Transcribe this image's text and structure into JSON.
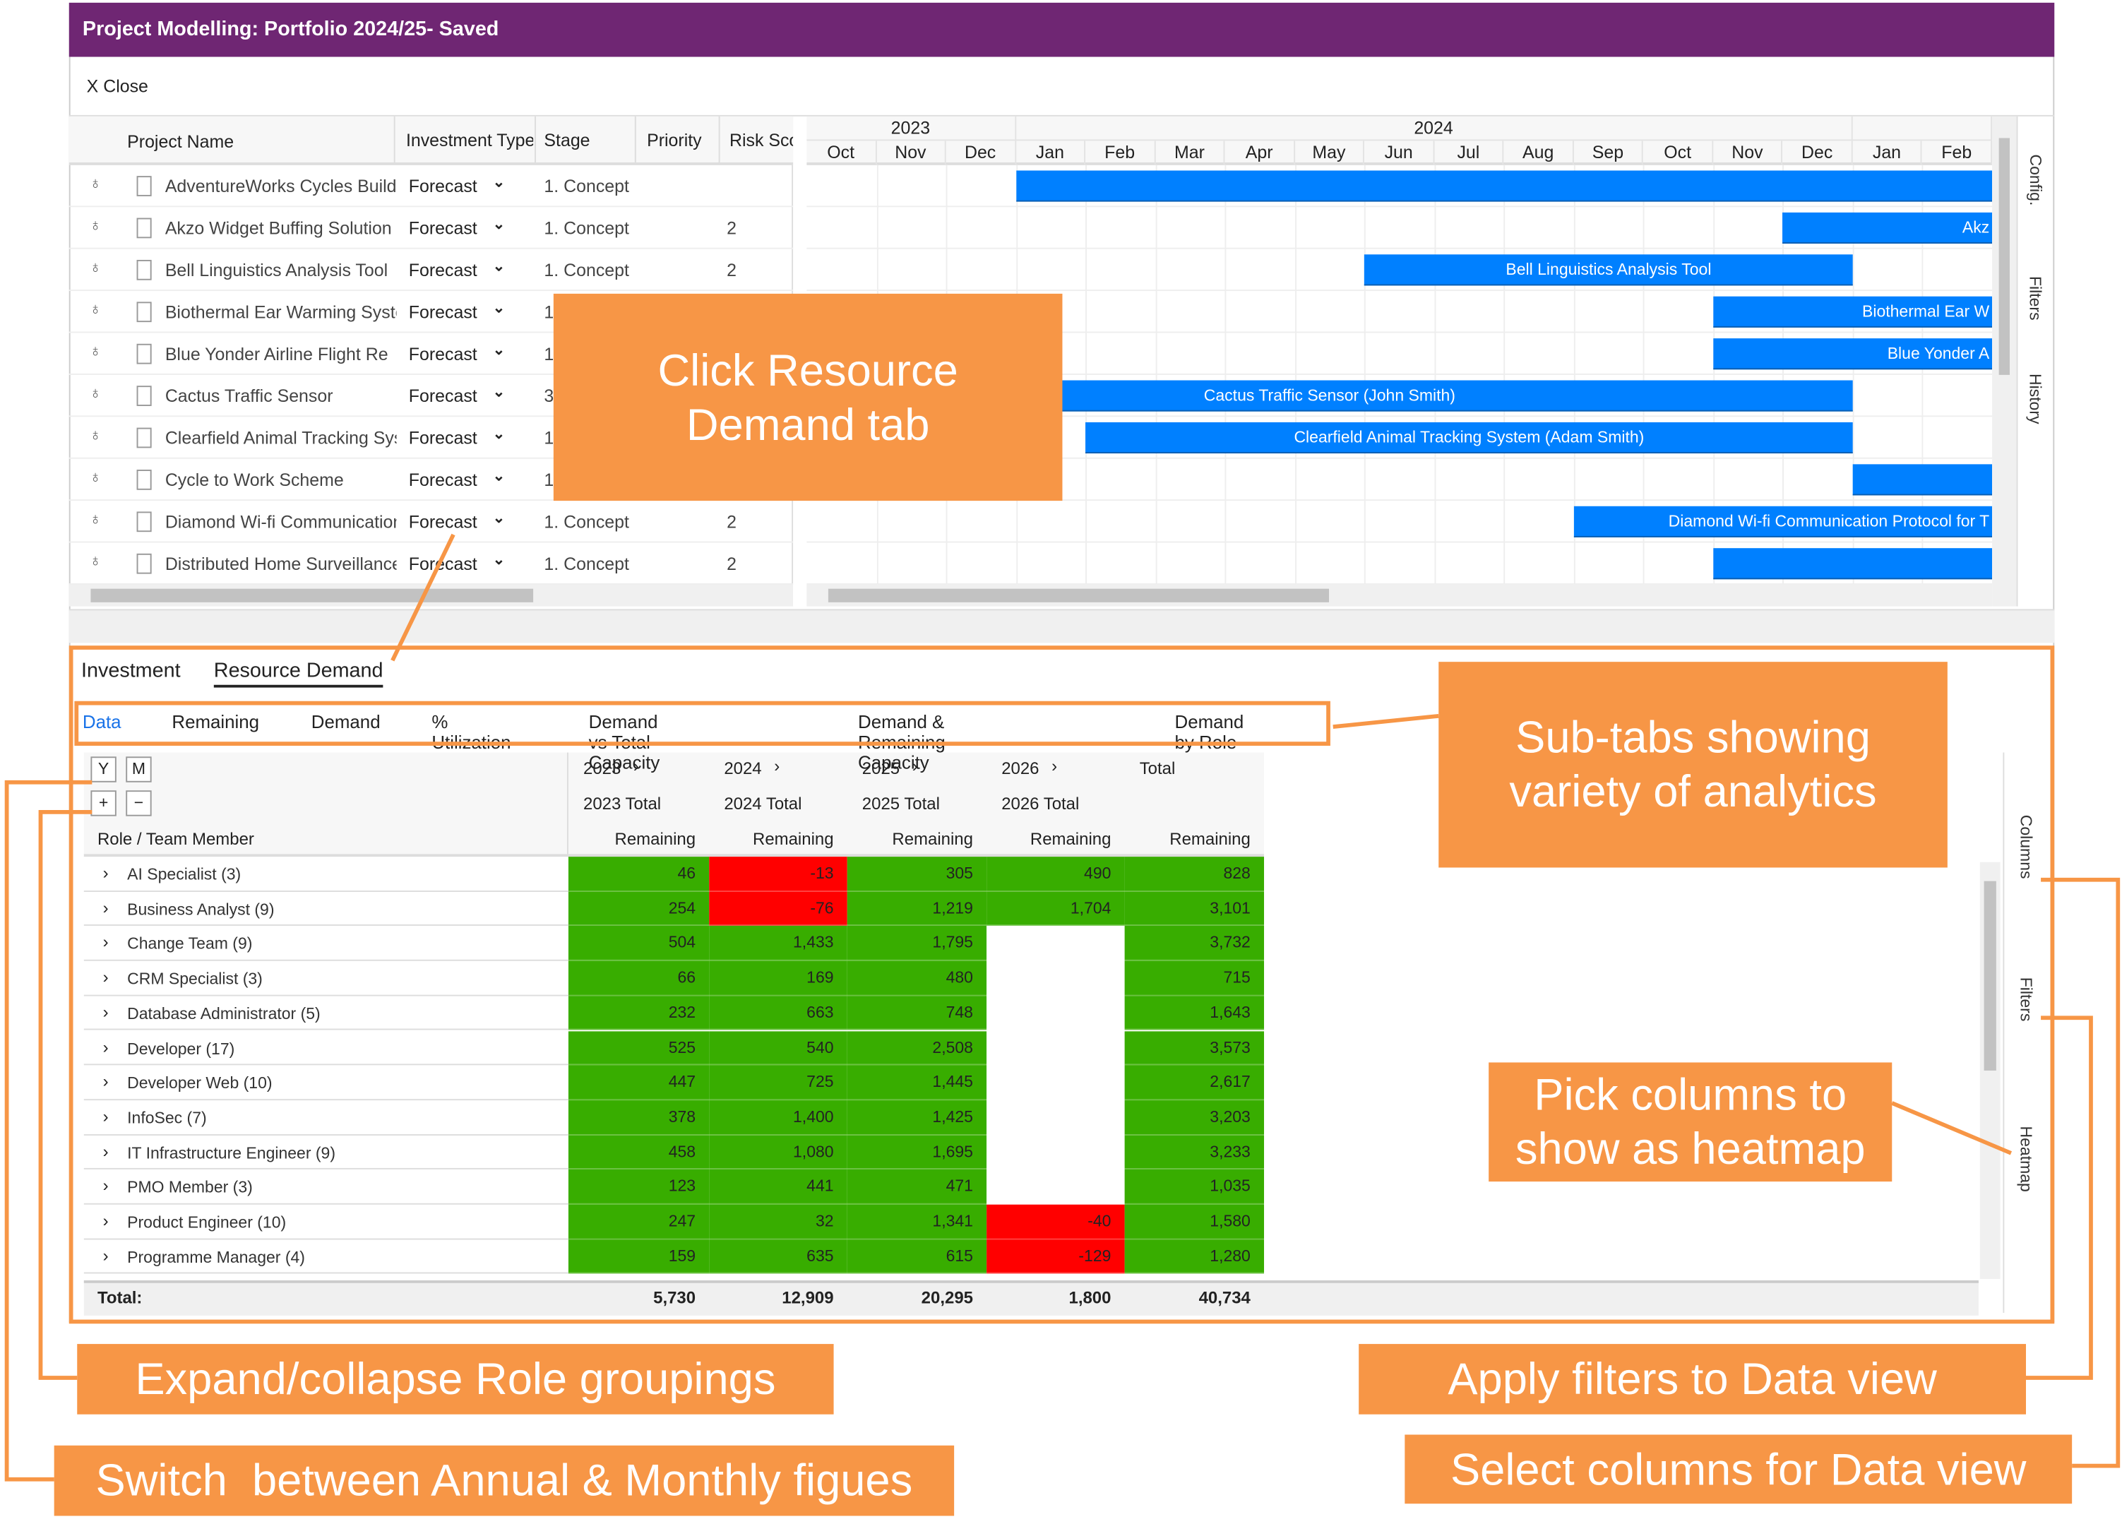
{
  "title": "Project Modelling: Portfolio 2024/25- Saved",
  "close_label": "X  Close",
  "grid": {
    "columns": [
      "Project Name",
      "Investment Type",
      "Stage",
      "Priority",
      "Risk Score"
    ],
    "rows": [
      {
        "name": "AdventureWorks Cycles Build",
        "type": "Forecast",
        "stage": "1. Concept",
        "priority": "",
        "risk": ""
      },
      {
        "name": "Akzo Widget Buffing Solution",
        "type": "Forecast",
        "stage": "1. Concept",
        "priority": "",
        "risk": "2"
      },
      {
        "name": "Bell Linguistics Analysis Tool",
        "type": "Forecast",
        "stage": "1. Concept",
        "priority": "",
        "risk": "2"
      },
      {
        "name": "Biothermal Ear Warming System",
        "type": "Forecast",
        "stage": "1. Concept",
        "priority": "",
        "risk": ""
      },
      {
        "name": "Blue Yonder Airline Flight Re",
        "type": "Forecast",
        "stage": "1. Concept",
        "priority": "",
        "risk": ""
      },
      {
        "name": "Cactus Traffic Sensor",
        "type": "Forecast",
        "stage": "3",
        "priority": "",
        "risk": ""
      },
      {
        "name": "Clearfield Animal Tracking System",
        "type": "Forecast",
        "stage": "1. Concept",
        "priority": "",
        "risk": ""
      },
      {
        "name": "Cycle to Work Scheme",
        "type": "Forecast",
        "stage": "1. Concept",
        "priority": "",
        "risk": ""
      },
      {
        "name": "Diamond Wi-fi Communication",
        "type": "Forecast",
        "stage": "1. Concept",
        "priority": "",
        "risk": "2"
      },
      {
        "name": "Distributed Home Surveillance",
        "type": "Forecast",
        "stage": "1. Concept",
        "priority": "",
        "risk": "2"
      }
    ]
  },
  "gantt": {
    "years": [
      {
        "label": "2023",
        "start": 0,
        "span": 3
      },
      {
        "label": "2024",
        "start": 3,
        "span": 12
      },
      {
        "label": "",
        "start": 15,
        "span": 2
      }
    ],
    "months": [
      "Oct",
      "Nov",
      "Dec",
      "Jan",
      "Feb",
      "Mar",
      "Apr",
      "May",
      "Jun",
      "Jul",
      "Aug",
      "Sep",
      "Oct",
      "Nov",
      "Dec",
      "Jan",
      "Feb"
    ],
    "bars": [
      {
        "start": "2024-01",
        "end": null,
        "label": ""
      },
      {
        "start": "2024-12",
        "end": null,
        "label": "Akz"
      },
      {
        "start": "2024-06",
        "end": "2024-12",
        "label": "Bell Linguistics Analysis Tool"
      },
      {
        "start": "2024-11",
        "end": null,
        "label": "Biothermal Ear W"
      },
      {
        "start": "2024-11",
        "end": null,
        "label": "Blue Yonder A"
      },
      {
        "start": "2023-10",
        "end": "2024-12",
        "label": "Cactus Traffic Sensor (John Smith)"
      },
      {
        "start": "2024-02",
        "end": "2024-12",
        "label": "Clearfield Animal Tracking System (Adam Smith)"
      },
      {
        "start": "2025-01",
        "end": null,
        "label": ""
      },
      {
        "start": "2024-09",
        "end": null,
        "label": "Diamond Wi-fi Communication Protocol for T"
      },
      {
        "start": "2024-11",
        "end": null,
        "label": ""
      }
    ]
  },
  "side_panel_top": [
    "Config.",
    "Filters",
    "History"
  ],
  "tabs": [
    "Investment",
    "Resource Demand"
  ],
  "active_tab": 1,
  "subtabs": [
    "Data",
    "Remaining",
    "Demand",
    "% Utilization",
    "Demand vs Total Capacity",
    "Demand & Remaining Capacity",
    "Demand by Role"
  ],
  "active_subtab": 0,
  "pivot": {
    "buttons": {
      "year": "Y",
      "month": "M",
      "expand": "+",
      "collapse": "−"
    },
    "years": [
      "2023",
      "2024",
      "2025",
      "2026",
      "Total"
    ],
    "totals": [
      "2023 Total",
      "2024 Total",
      "2025 Total",
      "2026 Total",
      ""
    ],
    "row_header": "Role / Team Member",
    "measure": "Remaining",
    "rows": [
      {
        "role": "AI Specialist (3)",
        "values": [
          "46",
          "-13",
          "305",
          "490",
          "828"
        ],
        "heat": [
          "g",
          "r",
          "g",
          "g",
          "g"
        ]
      },
      {
        "role": "Business Analyst (9)",
        "values": [
          "254",
          "-76",
          "1,219",
          "1,704",
          "3,101"
        ],
        "heat": [
          "g",
          "r",
          "g",
          "g",
          "g"
        ]
      },
      {
        "role": "Change Team (9)",
        "values": [
          "504",
          "1,433",
          "1,795",
          "",
          "3,732"
        ],
        "heat": [
          "g",
          "g",
          "g",
          "w",
          "g"
        ]
      },
      {
        "role": "CRM Specialist (3)",
        "values": [
          "66",
          "169",
          "480",
          "",
          "715"
        ],
        "heat": [
          "g",
          "g",
          "g",
          "w",
          "g"
        ]
      },
      {
        "role": "Database Administrator (5)",
        "values": [
          "232",
          "663",
          "748",
          "",
          "1,643"
        ],
        "heat": [
          "g",
          "g",
          "g",
          "w",
          "g"
        ]
      },
      {
        "role": "Developer (17)",
        "values": [
          "525",
          "540",
          "2,508",
          "",
          "3,573"
        ],
        "heat": [
          "g",
          "g",
          "g",
          "w",
          "g"
        ]
      },
      {
        "role": "Developer Web (10)",
        "values": [
          "447",
          "725",
          "1,445",
          "",
          "2,617"
        ],
        "heat": [
          "g",
          "g",
          "g",
          "w",
          "g"
        ]
      },
      {
        "role": "InfoSec (7)",
        "values": [
          "378",
          "1,400",
          "1,425",
          "",
          "3,203"
        ],
        "heat": [
          "g",
          "g",
          "g",
          "w",
          "g"
        ]
      },
      {
        "role": "IT Infrastructure Engineer (9)",
        "values": [
          "458",
          "1,080",
          "1,695",
          "",
          "3,233"
        ],
        "heat": [
          "g",
          "g",
          "g",
          "w",
          "g"
        ]
      },
      {
        "role": "PMO Member (3)",
        "values": [
          "123",
          "441",
          "471",
          "",
          "1,035"
        ],
        "heat": [
          "g",
          "g",
          "g",
          "w",
          "g"
        ]
      },
      {
        "role": "Product Engineer (10)",
        "values": [
          "247",
          "32",
          "1,341",
          "-40",
          "1,580"
        ],
        "heat": [
          "g",
          "g",
          "g",
          "r",
          "g"
        ]
      },
      {
        "role": "Programme Manager (4)",
        "values": [
          "159",
          "635",
          "615",
          "-129",
          "1,280"
        ],
        "heat": [
          "g",
          "g",
          "g",
          "r",
          "g"
        ]
      }
    ],
    "total_label": "Total:",
    "total_values": [
      "5,730",
      "12,909",
      "20,295",
      "1,800",
      "40,734"
    ]
  },
  "side_panel_bottom": [
    "Columns",
    "Filters",
    "Heatmap"
  ],
  "colors": {
    "title": "#6f2673",
    "bar": "#0080ff",
    "green": "#38ad00",
    "red": "#ff0000",
    "callout": "#f79646",
    "active": "#1a73e8"
  },
  "callouts": {
    "resource_tab": "Click Resource Demand tab",
    "subtabs": "Sub-tabs showing variety of analytics",
    "heatmap": "Pick columns to show as heatmap",
    "expand": "Expand/collapse Role groupings",
    "filters": "Apply filters to Data view",
    "switch": "Switch  between Annual & Monthly figues",
    "columns": "Select columns for Data view"
  }
}
